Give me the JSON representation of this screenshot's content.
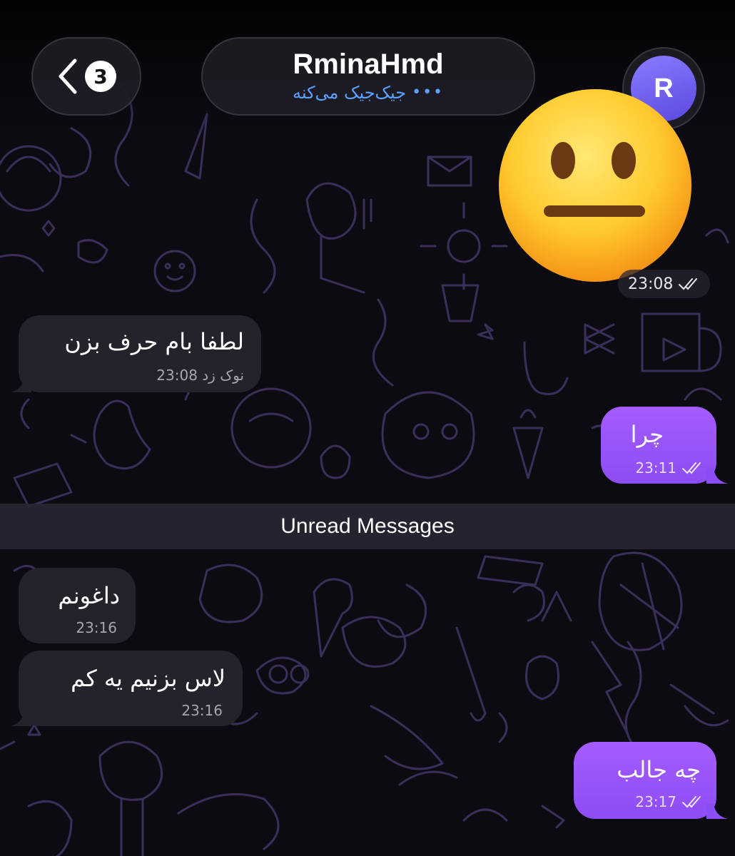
{
  "header": {
    "unread_count": "3",
    "chat_name": "RminaHmd",
    "status_text": "جیک‌جیک می‌کنه",
    "status_dots": "•••",
    "avatar_letter": "R"
  },
  "sticker": {
    "emoji": "neutral-face-emoji",
    "time": "23:08"
  },
  "messages": [
    {
      "direction": "in",
      "text": "لطفا بام حرف بزن",
      "time": "نوک زد 23:08"
    },
    {
      "direction": "out",
      "text": "چرا",
      "time": "23:11"
    },
    {
      "direction": "in",
      "text": "داغونم",
      "time": "23:16"
    },
    {
      "direction": "in",
      "text": "لاس بزنیم یه کم",
      "time": "23:16"
    },
    {
      "direction": "out",
      "text": "چه جالب",
      "time": "23:17"
    }
  ],
  "unread_divider": "Unread Messages",
  "colors": {
    "background": "#0d0b12",
    "incoming_bubble": "#24232b",
    "outgoing_bubble": "#9b57fb",
    "status_text": "#5aa2ff",
    "avatar": "#6f5ff0"
  }
}
